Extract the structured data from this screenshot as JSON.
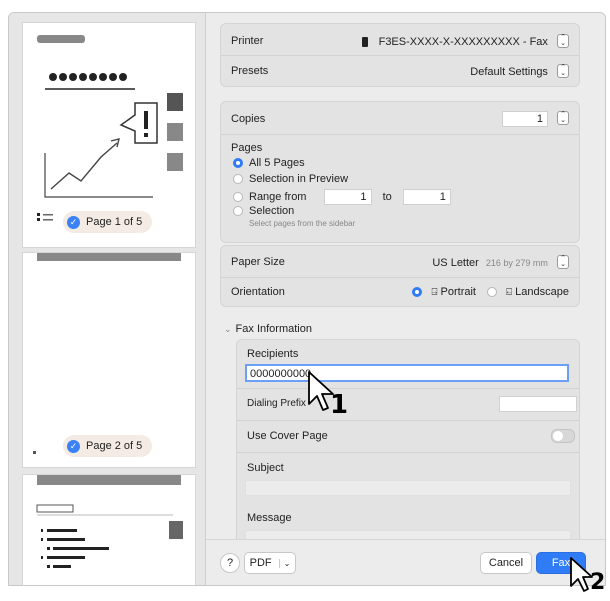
{
  "printer": {
    "label": "Printer",
    "value": "F3ES-XXXX-X-XXXXXXXXX - Fax"
  },
  "presets": {
    "label": "Presets",
    "value": "Default Settings"
  },
  "copies": {
    "label": "Copies",
    "value": "1"
  },
  "pages": {
    "label": "Pages",
    "all": "All 5 Pages",
    "selection_preview": "Selection in Preview",
    "range_label": "Range from",
    "range_from": "1",
    "range_to_label": "to",
    "range_to": "1",
    "selection": "Selection",
    "selection_hint": "Select pages from the sidebar"
  },
  "paper": {
    "label": "Paper Size",
    "value": "US Letter",
    "dims": "216 by 279 mm"
  },
  "orientation": {
    "label": "Orientation",
    "portrait": "Portrait",
    "landscape": "Landscape"
  },
  "fax": {
    "section": "Fax Information",
    "recipients_label": "Recipients",
    "recipients_value": "0000000000",
    "dialing_label": "Dialing Prefix",
    "cover_label": "Use Cover Page",
    "subject_label": "Subject",
    "message_label": "Message"
  },
  "footer": {
    "help": "?",
    "pdf": "PDF",
    "cancel": "Cancel",
    "fax": "Fax"
  },
  "thumbs": {
    "page1": "Page 1 of 5",
    "page2": "Page 2 of 5"
  },
  "callouts": {
    "one": "1",
    "two": "2"
  },
  "colors": {
    "accent": "#2f7cf6"
  }
}
